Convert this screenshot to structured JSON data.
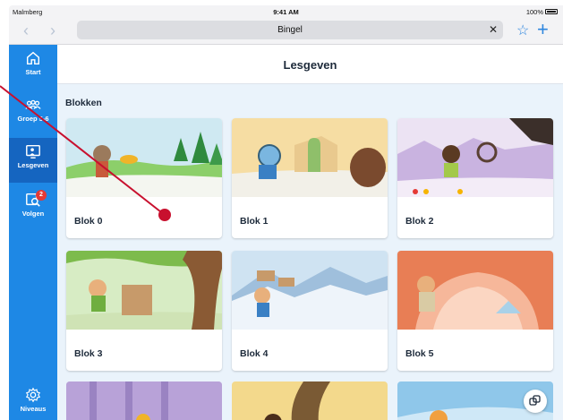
{
  "status": {
    "carrier": "Malmberg",
    "time": "9:41 AM",
    "battery": "100%"
  },
  "browser": {
    "url": "Bingel",
    "back_icon": "chevron-left-icon",
    "forward_icon": "chevron-right-icon",
    "clear_icon": "close-icon",
    "bookmark_icon": "star-icon",
    "new_tab_icon": "plus-icon"
  },
  "sidebar": {
    "items": [
      {
        "label": "Start",
        "icon": "home-icon"
      },
      {
        "label": "Groep 5-6",
        "icon": "group-icon"
      },
      {
        "label": "Lesgeven",
        "icon": "teach-icon",
        "active": true
      },
      {
        "label": "Volgen",
        "icon": "track-icon",
        "badge": "2"
      },
      {
        "label": "Niveaus",
        "icon": "gear-icon"
      }
    ]
  },
  "main": {
    "title": "Lesgeven",
    "section": "Blokken",
    "cards": [
      {
        "label": "Blok 0"
      },
      {
        "label": "Blok 1"
      },
      {
        "label": "Blok 2"
      },
      {
        "label": "Blok 3"
      },
      {
        "label": "Blok 4"
      },
      {
        "label": "Blok 5"
      }
    ]
  },
  "colors": {
    "accent": "#1e88e5",
    "accent_dark": "#1565c0",
    "badge": "#e53935",
    "annotation": "#c8102e"
  }
}
